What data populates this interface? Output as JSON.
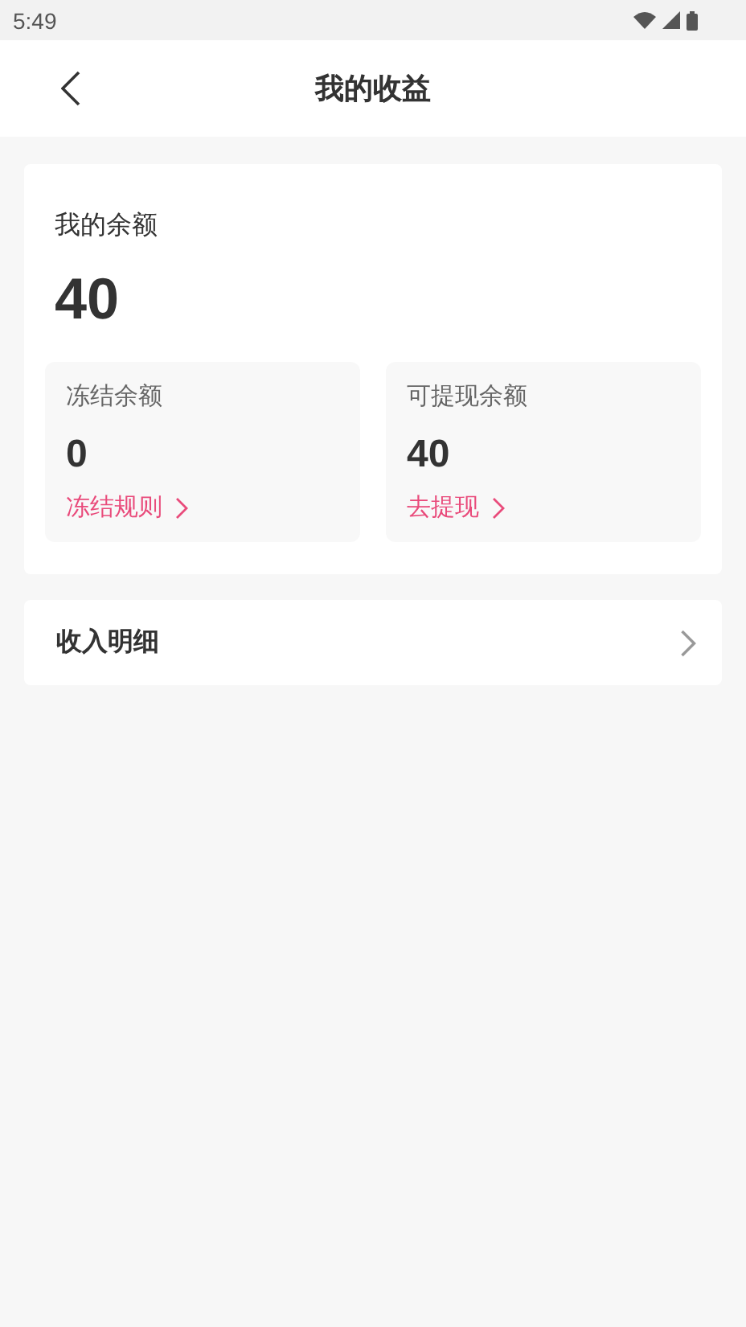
{
  "status_bar": {
    "time": "5:49"
  },
  "header": {
    "title": "我的收益"
  },
  "balance": {
    "label": "我的余额",
    "amount": "40",
    "boxes": [
      {
        "label": "冻结余额",
        "amount": "0",
        "link": "冻结规则"
      },
      {
        "label": "可提现余额",
        "amount": "40",
        "link": "去提现"
      }
    ]
  },
  "menu": [
    {
      "label": "收入明细"
    }
  ]
}
